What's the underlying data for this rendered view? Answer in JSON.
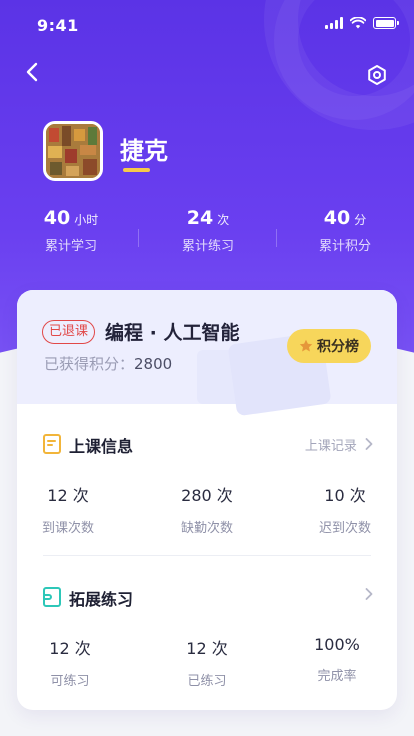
{
  "status_bar": {
    "time": "9:41"
  },
  "profile": {
    "name": "捷克"
  },
  "stats": [
    {
      "value": "40",
      "unit": "小时",
      "label": "累计学习"
    },
    {
      "value": "24",
      "unit": "次",
      "label": "累计练习"
    },
    {
      "value": "40",
      "unit": "分",
      "label": "累计积分"
    }
  ],
  "course": {
    "status_badge": "已退课",
    "title": "编程 · 人工智能",
    "points_label": "已获得积分：",
    "points_value": "2800",
    "rank_button": "积分榜"
  },
  "class_info": {
    "title": "上课信息",
    "link": "上课记录",
    "metrics": [
      {
        "value": "12 次",
        "label": "到课次数"
      },
      {
        "value": "280 次",
        "label": "缺勤次数"
      },
      {
        "value": "10 次",
        "label": "迟到次数"
      }
    ]
  },
  "practice": {
    "title": "拓展练习",
    "metrics": [
      {
        "value": "12 次",
        "label": "可练习"
      },
      {
        "value": "12 次",
        "label": "已练习"
      },
      {
        "value": "100%",
        "label": "完成率"
      }
    ]
  },
  "colors": {
    "primary": "#5b33e6",
    "accent": "#f7d65b",
    "badge": "#e14848"
  }
}
